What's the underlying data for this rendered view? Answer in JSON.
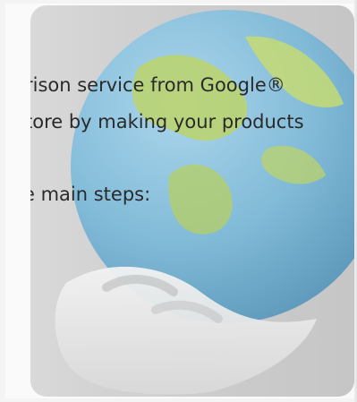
{
  "dialog": {
    "intro": {
      "line1": "rison service from Google®",
      "line2": "tore by making your products"
    },
    "steps_intro": "e main steps:"
  },
  "watermark": {
    "icon": "globe-with-hand-icon"
  },
  "colors": {
    "text": "#2a2a2a",
    "panel_bg": "#fafafa",
    "watermark_frame": "#c9c9c9",
    "globe_blue": "#77b8d9",
    "globe_green": "#bcd36a"
  }
}
